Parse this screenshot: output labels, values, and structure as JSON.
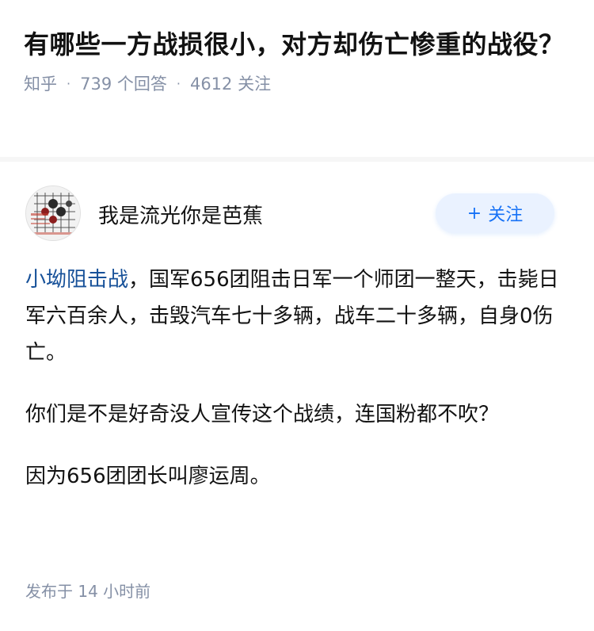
{
  "question": {
    "title": "有哪些一方战损很小，对方却伤亡惨重的战役？",
    "source": "知乎",
    "answers": "739 个回答",
    "followers": "4612 关注",
    "separator": "·"
  },
  "answer": {
    "author_name": "我是流光你是芭蕉",
    "follow_label": "关注",
    "follow_plus": "+",
    "p1_link": "小坳阻击战",
    "p1_text": "，国军656团阻击日军一个师团一整天，击毙日军六百余人，击毁汽车七十多辆，战车二十多辆，自身0伤亡。",
    "p2": "你们是不是好奇没人宣传这个战绩，连国粉都不吹？",
    "p3": "因为656团团长叫廖运周。",
    "published": "发布于  14 小时前"
  },
  "colors": {
    "link": "#175199",
    "meta": "#8590a6",
    "follow_accent": "#1772f6",
    "follow_bg": "#eaf2ff"
  },
  "icons": {
    "avatar": "chess-board-avatar"
  }
}
